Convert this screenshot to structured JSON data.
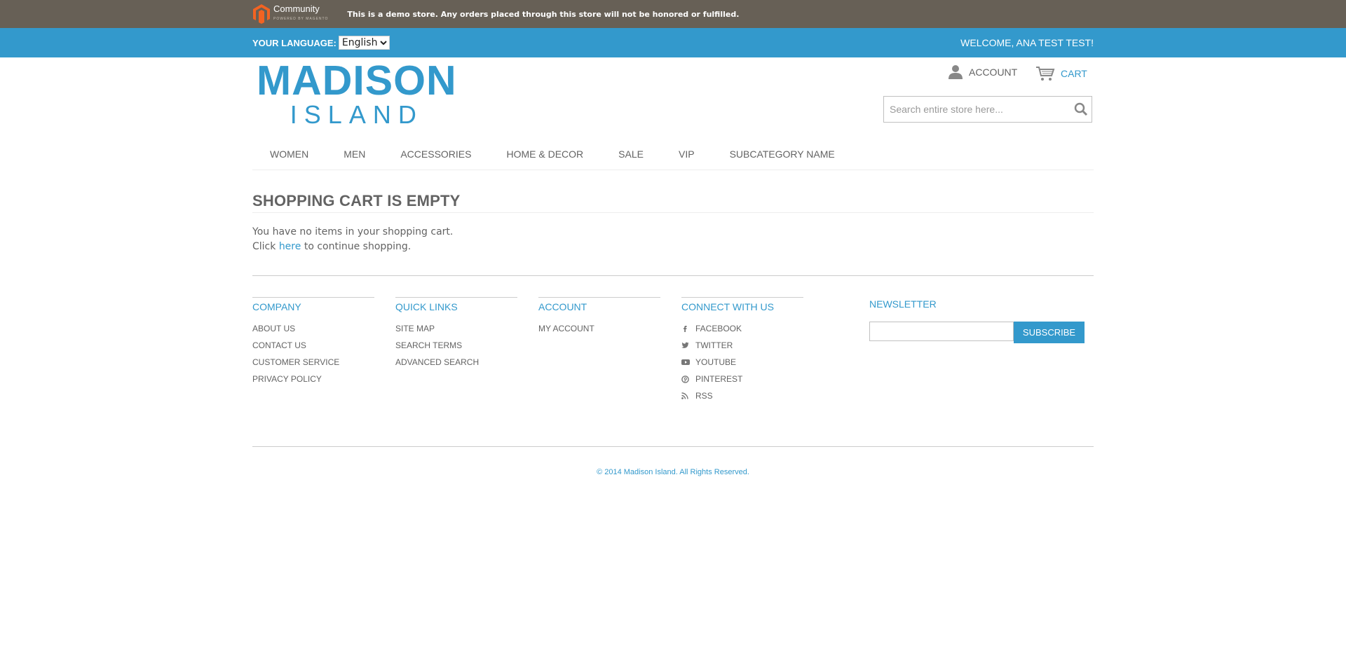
{
  "demo_notice": {
    "logo_word": "Community",
    "logo_sub": "POWERED BY MAGENTO",
    "text": "This is a demo store. Any orders placed through this store will not be honored or fulfilled."
  },
  "language_bar": {
    "label": "YOUR LANGUAGE:",
    "selected": "English",
    "welcome": "WELCOME, ANA TEST TEST!"
  },
  "header": {
    "logo_line1": "MADISON",
    "logo_line2": "ISLAND",
    "account_label": "ACCOUNT",
    "cart_label": "CART",
    "search_placeholder": "Search entire store here..."
  },
  "nav": [
    "WOMEN",
    "MEN",
    "ACCESSORIES",
    "HOME & DECOR",
    "SALE",
    "VIP",
    "SUBCATEGORY NAME"
  ],
  "main": {
    "title": "SHOPPING CART IS EMPTY",
    "message": "You have no items in your shopping cart.",
    "click_prefix": "Click ",
    "click_link": "here",
    "click_suffix": " to continue shopping."
  },
  "footer": {
    "company": {
      "title": "COMPANY",
      "links": [
        "ABOUT US",
        "CONTACT US",
        "CUSTOMER SERVICE",
        "PRIVACY POLICY"
      ]
    },
    "quick_links": {
      "title": "QUICK LINKS",
      "links": [
        "SITE MAP",
        "SEARCH TERMS",
        "ADVANCED SEARCH"
      ]
    },
    "account": {
      "title": "ACCOUNT",
      "links": [
        "MY ACCOUNT"
      ]
    },
    "connect": {
      "title": "CONNECT WITH US",
      "links": [
        "FACEBOOK",
        "TWITTER",
        "YOUTUBE",
        "PINTEREST",
        "RSS"
      ]
    },
    "newsletter": {
      "title": "NEWSLETTER",
      "button": "SUBSCRIBE"
    },
    "copyright": "© 2014 Madison Island. All Rights Reserved."
  },
  "colors": {
    "brand": "#3399cc",
    "demo_bar": "#676056",
    "text": "#636363"
  }
}
